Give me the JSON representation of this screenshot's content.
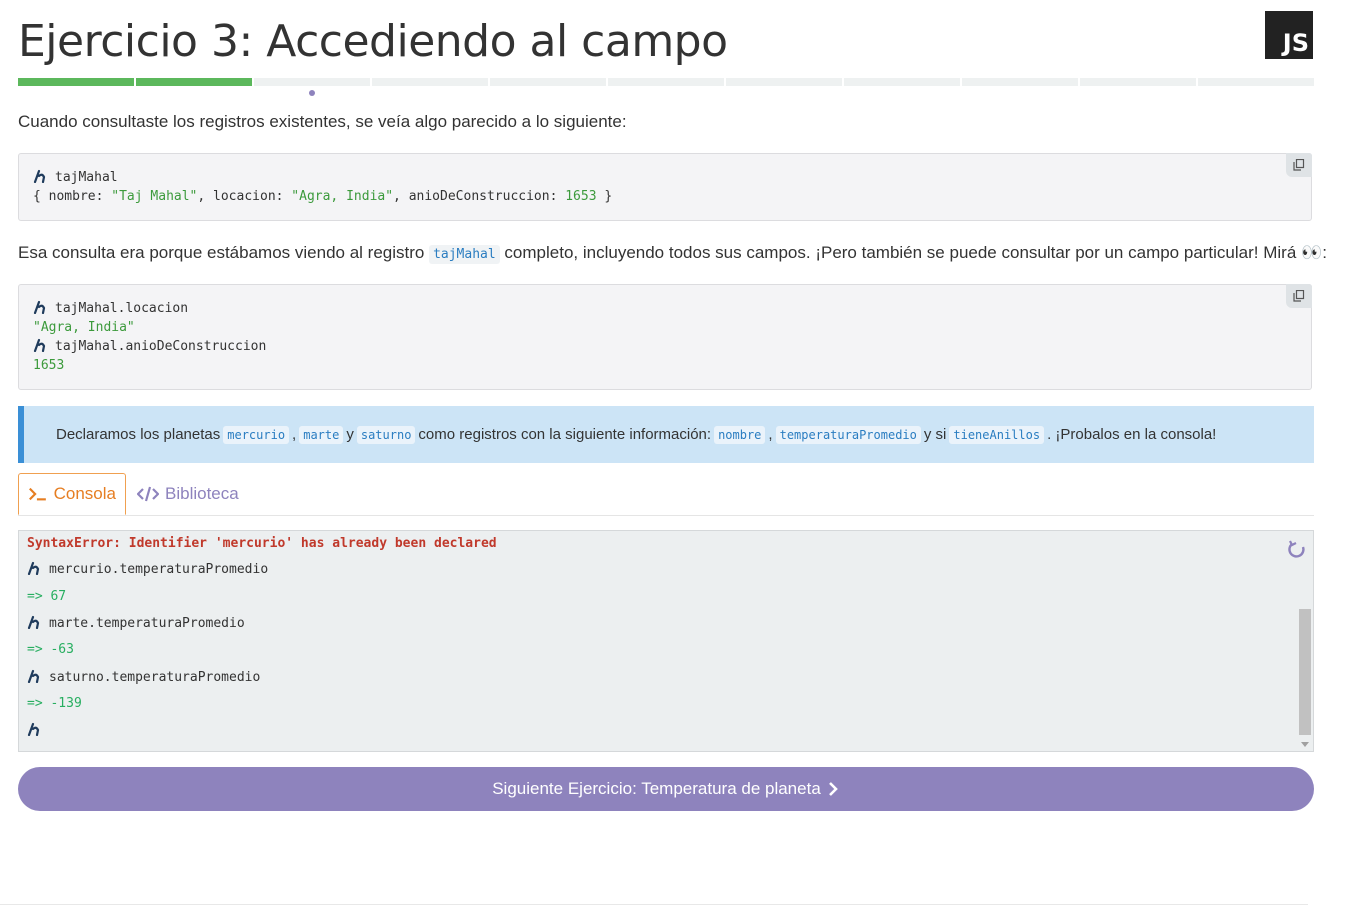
{
  "header": {
    "title": "Ejercicio 3: Accediendo al campo",
    "badge": "JS"
  },
  "progress": {
    "total_segments": 11,
    "completed_segments": 2,
    "current_segment": 3,
    "done_color": "#5cb85c",
    "pending_color": "#eef1f1"
  },
  "intro": {
    "text": "Cuando consultaste los registros existentes, se veía algo parecido a lo siguiente:"
  },
  "code_block_1": {
    "line1": "tajMahal",
    "line2": {
      "open": "{ nombre: ",
      "nombre_val": "\"Taj Mahal\"",
      "sep1": ", locacion: ",
      "locacion_val": "\"Agra, India\"",
      "sep2": ", anioDeConstruccion: ",
      "anio_val": "1653",
      "close": " }"
    }
  },
  "explain": {
    "before": "Esa consulta era porque estábamos viendo al registro ",
    "code": "tajMahal",
    "after": " completo, incluyendo todos sus campos. ¡Pero también se puede consultar por un campo particular! Mirá ",
    "emoji": "👀",
    "end": ":"
  },
  "code_block_2": {
    "line1": "tajMahal.locacion",
    "line2": "\"Agra, India\"",
    "line3": "tajMahal.anioDeConstruccion",
    "line4": "1653"
  },
  "info": {
    "t1": "Declaramos los planetas ",
    "c1": "mercurio",
    "t2": ",",
    "c2": "marte",
    "t3": " y ",
    "c3": "saturno",
    "t4": " como registros con la siguiente información: ",
    "c4": "nombre",
    "t5": ",",
    "c5": "temperaturaPromedio",
    "t6": " y si ",
    "c6": "tieneAnillos",
    "t7": ". ¡Probalos en la consola!"
  },
  "tabs": {
    "console_label": "Consola",
    "library_label": "Biblioteca"
  },
  "console": {
    "error": "SyntaxError: Identifier 'mercurio' has already been declared",
    "cmd1": "mercurio.temperaturaPromedio",
    "res1": "=> 67",
    "cmd2": "marte.temperaturaPromedio",
    "res2": "=> -63",
    "cmd3": "saturno.temperaturaPromedio",
    "res3": "=> -139"
  },
  "next_button": {
    "label": "Siguiente Ejercicio: Temperatura de planeta"
  },
  "colors": {
    "accent": "#8e83bd",
    "console_tab": "#e67e22",
    "info_bg": "#cce4f6",
    "error": "#c0392b",
    "result": "#27ae60"
  }
}
